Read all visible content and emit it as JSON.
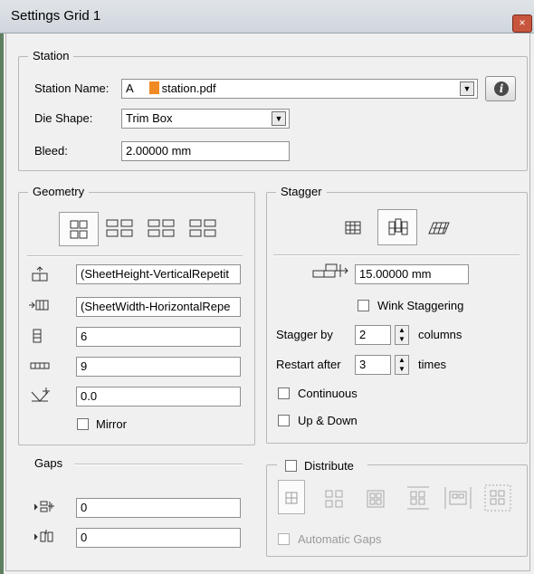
{
  "window": {
    "title": "Settings Grid 1",
    "close_glyph": "×"
  },
  "station": {
    "legend": "Station",
    "name_label": "Station Name:",
    "name_value": "A",
    "name_file": "station.pdf",
    "die_shape_label": "Die Shape:",
    "die_shape_value": "Trim Box",
    "bleed_label": "Bleed:",
    "bleed_value": "2.00000 mm",
    "info_glyph": "i"
  },
  "geometry": {
    "legend": "Geometry",
    "layout_icons": [
      "layout-2x2-icon",
      "layout-2x2-variant-icon",
      "layout-2x2-variant-icon",
      "layout-2x2-variant-icon"
    ],
    "vertical_gap_value": "(SheetHeight-VerticalRepetit",
    "horizontal_gap_value": "(SheetWidth-HorizontalRepe",
    "rows_value": "6",
    "columns_value": "9",
    "angle_value": "0.0",
    "mirror_label": "Mirror",
    "mirror_checked": false
  },
  "gaps": {
    "legend": "Gaps",
    "horizontal_gap_value": "0",
    "vertical_gap_value": "0"
  },
  "stagger": {
    "legend": "Stagger",
    "mode_icons": [
      "grid-icon",
      "stagger-columns-icon",
      "stagger-rows-icon"
    ],
    "offset_value": "15.00000 mm",
    "wink_label": "Wink Staggering",
    "wink_checked": false,
    "stagger_by_label": "Stagger by",
    "stagger_by_value": "2",
    "stagger_by_unit": "columns",
    "restart_label": "Restart after",
    "restart_value": "3",
    "restart_unit": "times",
    "continuous_label": "Continuous",
    "continuous_checked": false,
    "updown_label": "Up & Down",
    "updown_checked": false
  },
  "distribute": {
    "label": "Distribute",
    "checked": false,
    "automatic_gaps_label": "Automatic Gaps",
    "automatic_gaps_checked": false
  },
  "colors": {
    "accent": "#f08a24",
    "titlebar": "#d5dbe1",
    "close": "#c8553d"
  }
}
